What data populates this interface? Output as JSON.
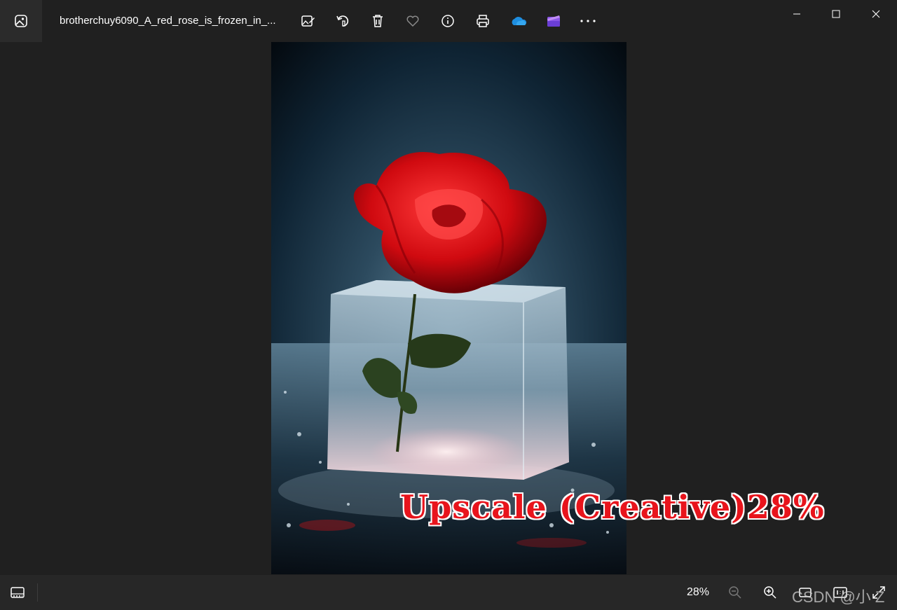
{
  "titlebar": {
    "filename": "brotherchuy6090_A_red_rose_is_frozen_in_...",
    "toolbar": [
      {
        "name": "edit-image-icon",
        "label": "Edit image"
      },
      {
        "name": "rotate-icon",
        "label": "Rotate"
      },
      {
        "name": "delete-icon",
        "label": "Delete"
      },
      {
        "name": "favorite-icon",
        "label": "Favorite"
      },
      {
        "name": "info-icon",
        "label": "File info"
      },
      {
        "name": "print-icon",
        "label": "Print"
      },
      {
        "name": "onedrive-icon",
        "label": "OneDrive"
      },
      {
        "name": "clipchamp-icon",
        "label": "Clipchamp"
      },
      {
        "name": "more-icon",
        "label": "See more"
      }
    ],
    "window_controls": [
      "minimize-icon",
      "maximize-icon",
      "close-icon"
    ]
  },
  "statusbar": {
    "zoom": "28%",
    "icons": [
      "filmstrip-icon",
      "zoom-out-icon",
      "zoom-in-icon",
      "fit-icon",
      "actual-size-icon",
      "fullscreen-icon"
    ]
  },
  "overlay": {
    "caption": "Upscale (Creative)28%",
    "watermark": "CSDN @小 Z"
  },
  "colors": {
    "background": "#202020",
    "statusbar": "#272727",
    "caption_red": "#e8141c",
    "onedrive_blue": "#1e8ee0",
    "clipchamp_purple": "#8a56e8"
  }
}
